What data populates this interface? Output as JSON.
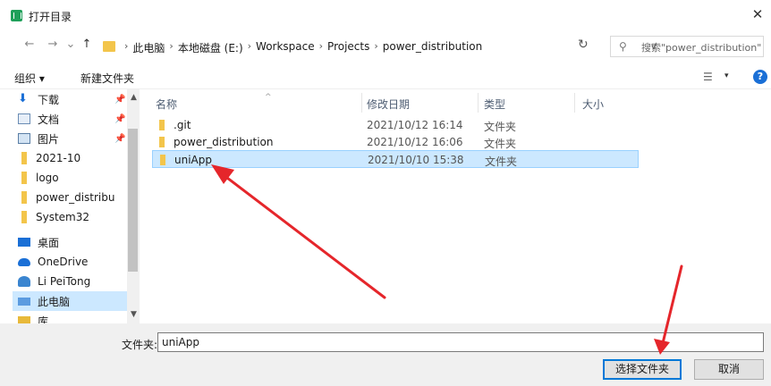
{
  "window": {
    "title": "打开目录",
    "close_glyph": "✕"
  },
  "nav": {
    "back": "←",
    "forward": "→",
    "recent": "⌄",
    "up": "↑"
  },
  "breadcrumbs": [
    "此电脑",
    "本地磁盘 (E:)",
    "Workspace",
    "Projects",
    "power_distribution"
  ],
  "breadcrumb_separator": "›",
  "search": {
    "placeholder": "搜索\"power_distribution\""
  },
  "toolbar": {
    "organize": "组织 ▾",
    "new_folder": "新建文件夹",
    "help": "?"
  },
  "sidebar": {
    "items": [
      {
        "label": "下载",
        "icon": "download-icon",
        "pinned": true
      },
      {
        "label": "文档",
        "icon": "document-icon",
        "pinned": true
      },
      {
        "label": "图片",
        "icon": "picture-icon",
        "pinned": true
      },
      {
        "label": "2021-10",
        "icon": "folder-icon"
      },
      {
        "label": "logo",
        "icon": "folder-icon"
      },
      {
        "label": "power_distribu",
        "icon": "folder-icon"
      },
      {
        "label": "System32",
        "icon": "folder-icon"
      },
      {
        "label": "桌面",
        "icon": "desktop-icon"
      },
      {
        "label": "OneDrive",
        "icon": "cloud-icon"
      },
      {
        "label": "Li PeiTong",
        "icon": "user-icon"
      },
      {
        "label": "此电脑",
        "icon": "computer-icon",
        "selected": true
      },
      {
        "label": "库",
        "icon": "library-icon"
      }
    ]
  },
  "columns": {
    "name": "名称",
    "modified": "修改日期",
    "type": "类型",
    "size": "大小"
  },
  "files": [
    {
      "name": ".git",
      "modified": "2021/10/12 16:14",
      "type": "文件夹"
    },
    {
      "name": "power_distribution",
      "modified": "2021/10/12 16:06",
      "type": "文件夹"
    },
    {
      "name": "uniApp",
      "modified": "2021/10/10 15:38",
      "type": "文件夹",
      "selected": true
    }
  ],
  "footer": {
    "folder_label": "文件夹:",
    "folder_value": "uniApp",
    "select_button": "选择文件夹",
    "cancel_button": "取消"
  },
  "annotation_color": "#e5262b",
  "accent_color": "#0078d7",
  "selection_color": "#cce8ff"
}
